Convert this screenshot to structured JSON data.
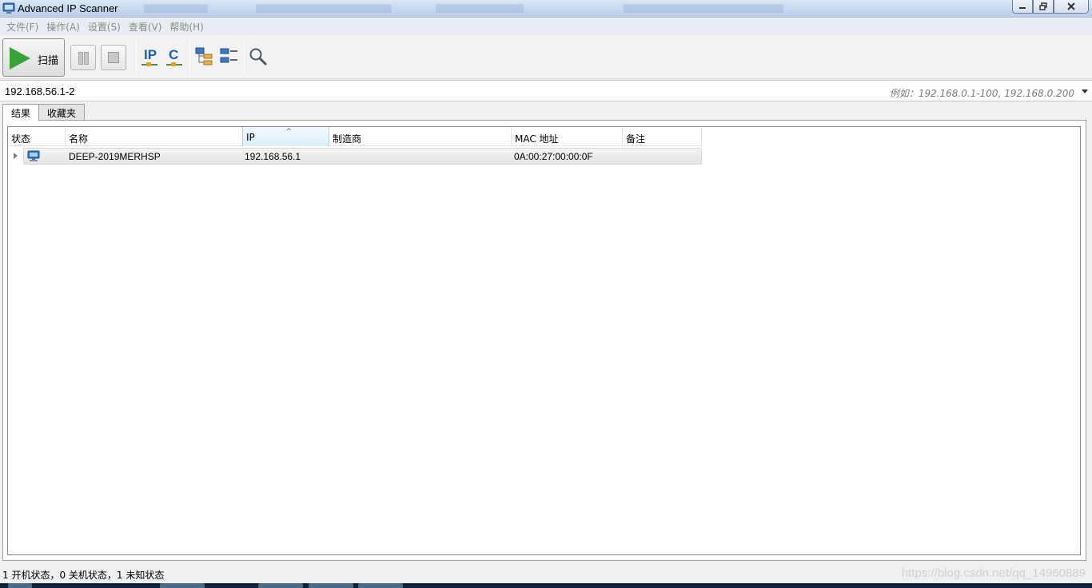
{
  "window": {
    "title": "Advanced IP Scanner",
    "controls": {
      "minimize": "minimize",
      "restore": "restore",
      "close": "close"
    }
  },
  "menu": [
    "文件(F)",
    "操作(A)",
    "设置(S)",
    "查看(V)",
    "帮助(H)"
  ],
  "toolbar": {
    "scan_label": "扫描",
    "ip_label": "IP",
    "c_label": "C"
  },
  "address": {
    "value": "192.168.56.1-2",
    "hint": "例如：192.168.0.1-100, 192.168.0.200"
  },
  "tabs": [
    "结果",
    "收藏夹"
  ],
  "table": {
    "columns": [
      "状态",
      "名称",
      "IP",
      "制造商",
      "MAC 地址",
      "备注"
    ],
    "sorted_column": "IP",
    "rows": [
      {
        "status_icon": "computer-icon",
        "name": "DEEP-2019MERHSP",
        "ip": "192.168.56.1",
        "vendor": "",
        "mac": "0A:00:27:00:00:0F",
        "note": ""
      }
    ]
  },
  "status": {
    "text": "1 开机状态，0 关机状态，1 未知状态",
    "watermark": "https://blog.csdn.net/qq_14960889"
  },
  "colors": {
    "play": "#3aa23a",
    "icon_blue": "#1a5fb4"
  }
}
